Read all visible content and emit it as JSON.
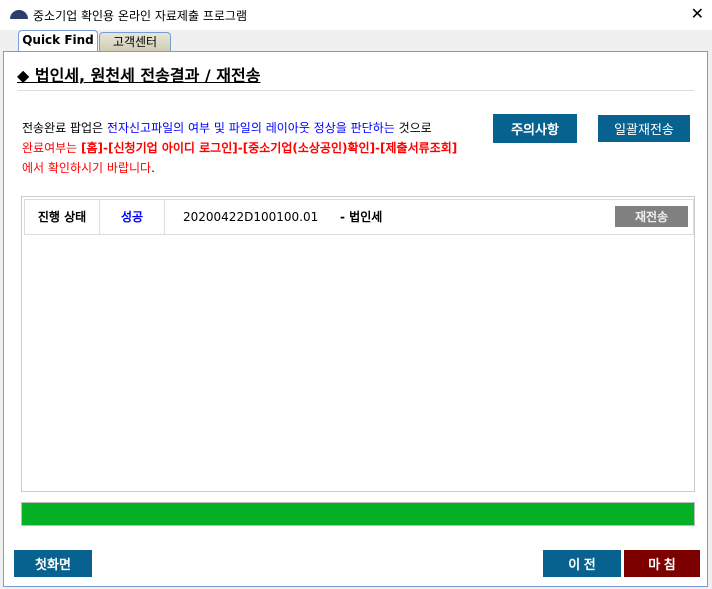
{
  "window": {
    "title": "중소기업 확인용 온라인 자료제출 프로그램",
    "close": "✕"
  },
  "tabs": [
    {
      "label": "Quick Find"
    },
    {
      "label": "고객센터"
    }
  ],
  "heading": "◆ 법인세, 원천세 전송결과 / 재전송",
  "message": {
    "l1a": "전송완료 팝업은 ",
    "l1b": "전자신고파일의 여부 및 파일의 레이아웃 정상을 판단하는",
    "l1c": " 것으로",
    "l2a": "완료여부는 ",
    "l2b": "[홈]-[신청기업 아이디 로그인]-[중소기업(소상공인)확인]-[제출서류조회]",
    "l3a": "에서 확인하시기 바랍니다",
    "l3b": "."
  },
  "buttons": {
    "notice": "주의사항",
    "resend_all": "일괄재전송",
    "home": "첫화면",
    "prev": "이 전",
    "finish": "마 침"
  },
  "row": {
    "label": "진행 상태",
    "status": "성공",
    "id": "20200422D100100.01",
    "type": "- 법인세",
    "resend": "재전송"
  },
  "progress": {
    "percent": 100
  },
  "colors": {
    "navy": "#08628f",
    "finish": "#7d0000",
    "progress": "#06b025"
  }
}
